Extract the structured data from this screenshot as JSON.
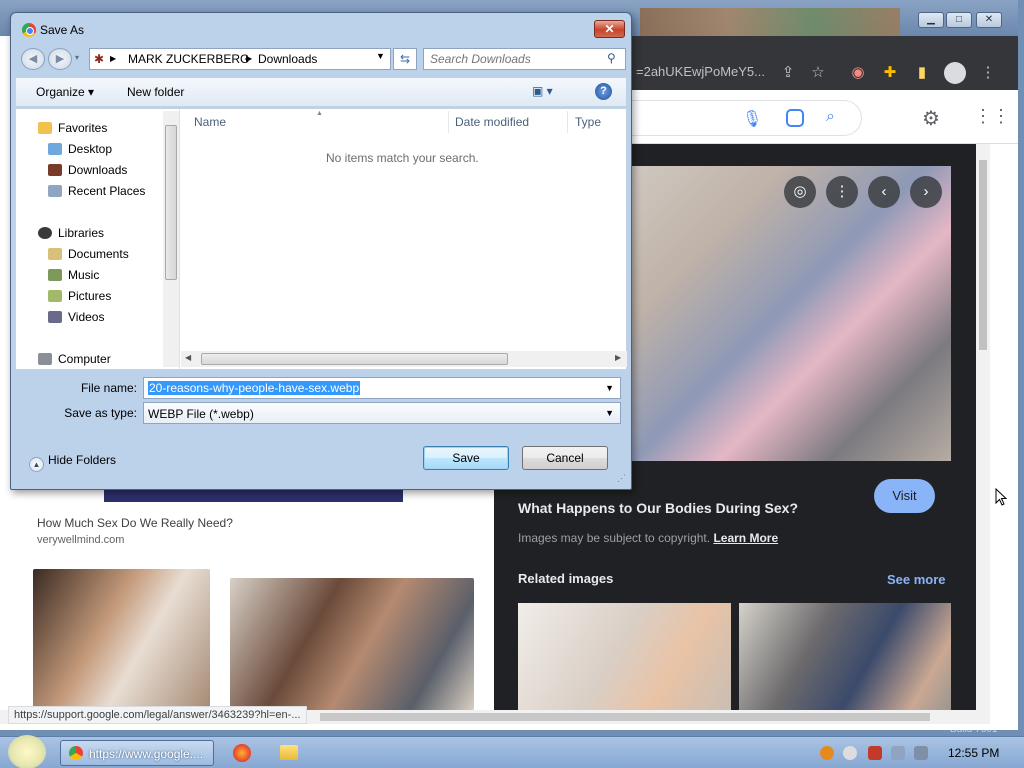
{
  "browser": {
    "url_fragment": "=2ahUKEwjPoMeY5...",
    "viewer": {
      "visit_label": "Visit",
      "title": "What Happens to Our Bodies During Sex?",
      "copyright_note": "Images may be subject to copyright.",
      "learn_more": "Learn More",
      "related_title": "Related images",
      "see_more": "See more"
    },
    "left_result": {
      "caption": "How Much Sex Do We Really Need?",
      "source": "verywellmind.com"
    },
    "status_url": "https://support.google.com/legal/answer/3463239?hl=en-...",
    "build_text": "Build 7601"
  },
  "dialog": {
    "title": "Save As",
    "close_glyph": "✕",
    "breadcrumb": [
      "MARK ZUCKERBERG",
      "Downloads"
    ],
    "search_placeholder": "Search Downloads",
    "organize_label": "Organize ▾",
    "new_folder_label": "New folder",
    "nav": {
      "favorites": "Favorites",
      "desktop": "Desktop",
      "downloads": "Downloads",
      "recent": "Recent Places",
      "libraries": "Libraries",
      "documents": "Documents",
      "music": "Music",
      "pictures": "Pictures",
      "videos": "Videos",
      "computer": "Computer"
    },
    "columns": {
      "name": "Name",
      "date": "Date modified",
      "type": "Type"
    },
    "empty_message": "No items match your search.",
    "file_name_label": "File name:",
    "file_name_value": "20-reasons-why-people-have-sex.webp",
    "save_type_label": "Save as type:",
    "save_type_value": "WEBP File (*.webp)",
    "hide_folders_label": "Hide Folders",
    "save_label": "Save",
    "cancel_label": "Cancel"
  },
  "taskbar": {
    "chrome_label": "https://www.google....",
    "clock": "12:55 PM"
  },
  "icons": {
    "chrome": "chrome-icon",
    "search": "search-icon",
    "help": "help-icon",
    "firefox": "firefox-icon",
    "folder": "folder-icon"
  }
}
